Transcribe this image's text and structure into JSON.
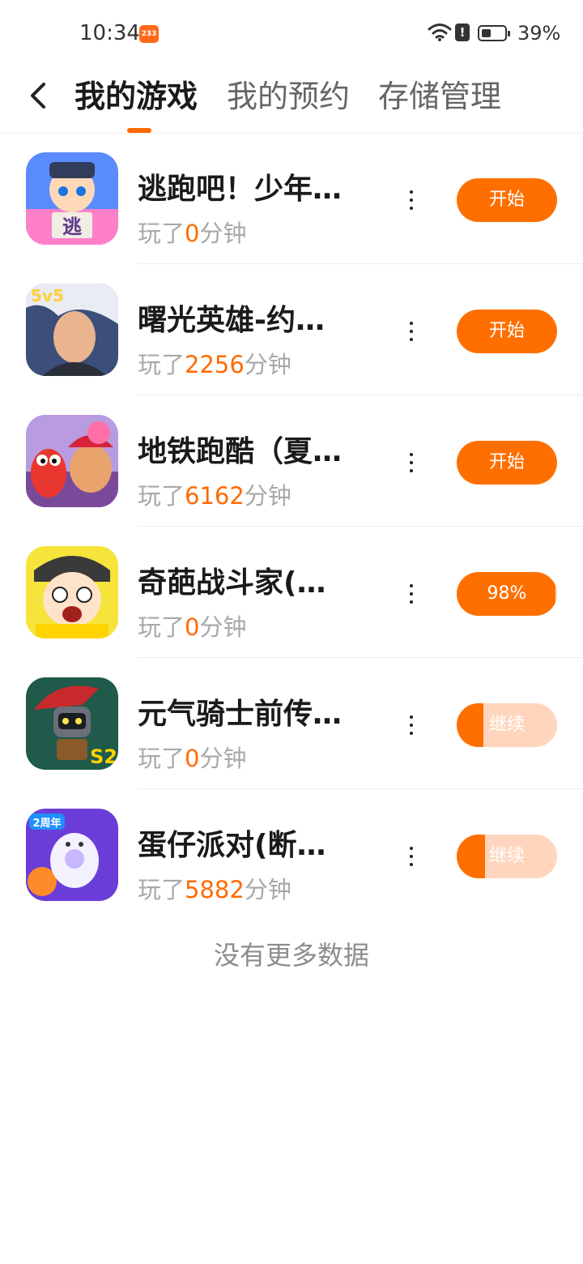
{
  "status_bar": {
    "time": "10:34",
    "app_badge": "233",
    "battery": "39%"
  },
  "header": {
    "tabs": [
      {
        "label": "我的游戏",
        "active": true
      },
      {
        "label": "我的预约",
        "active": false
      },
      {
        "label": "存储管理",
        "active": false
      }
    ]
  },
  "games": [
    {
      "title": "逃跑吧！少年…",
      "played_prefix": "玩了",
      "minutes": "0",
      "played_suffix": "分钟",
      "action": "开始",
      "state": "start"
    },
    {
      "title": "曙光英雄-约…",
      "played_prefix": "玩了",
      "minutes": "2256",
      "played_suffix": "分钟",
      "action": "开始",
      "state": "start"
    },
    {
      "title": "地铁跑酷（夏…",
      "played_prefix": "玩了",
      "minutes": "6162",
      "played_suffix": "分钟",
      "action": "开始",
      "state": "start"
    },
    {
      "title": "奇葩战斗家(…",
      "played_prefix": "玩了",
      "minutes": "0",
      "played_suffix": "分钟",
      "action": "98%",
      "state": "downloading",
      "progress": 0.98
    },
    {
      "title": "元气骑士前传…",
      "played_prefix": "玩了",
      "minutes": "0",
      "played_suffix": "分钟",
      "action": "继续",
      "state": "paused",
      "progress": 0.27
    },
    {
      "title": "蛋仔派对(断…",
      "played_prefix": "玩了",
      "minutes": "5882",
      "played_suffix": "分钟",
      "action": "继续",
      "state": "paused",
      "progress": 0.28
    }
  ],
  "footer": {
    "no_more": "没有更多数据"
  },
  "colors": {
    "accent": "#ff6f00",
    "accent_light": "#ffd6bd",
    "muted": "#a8a8a8"
  }
}
